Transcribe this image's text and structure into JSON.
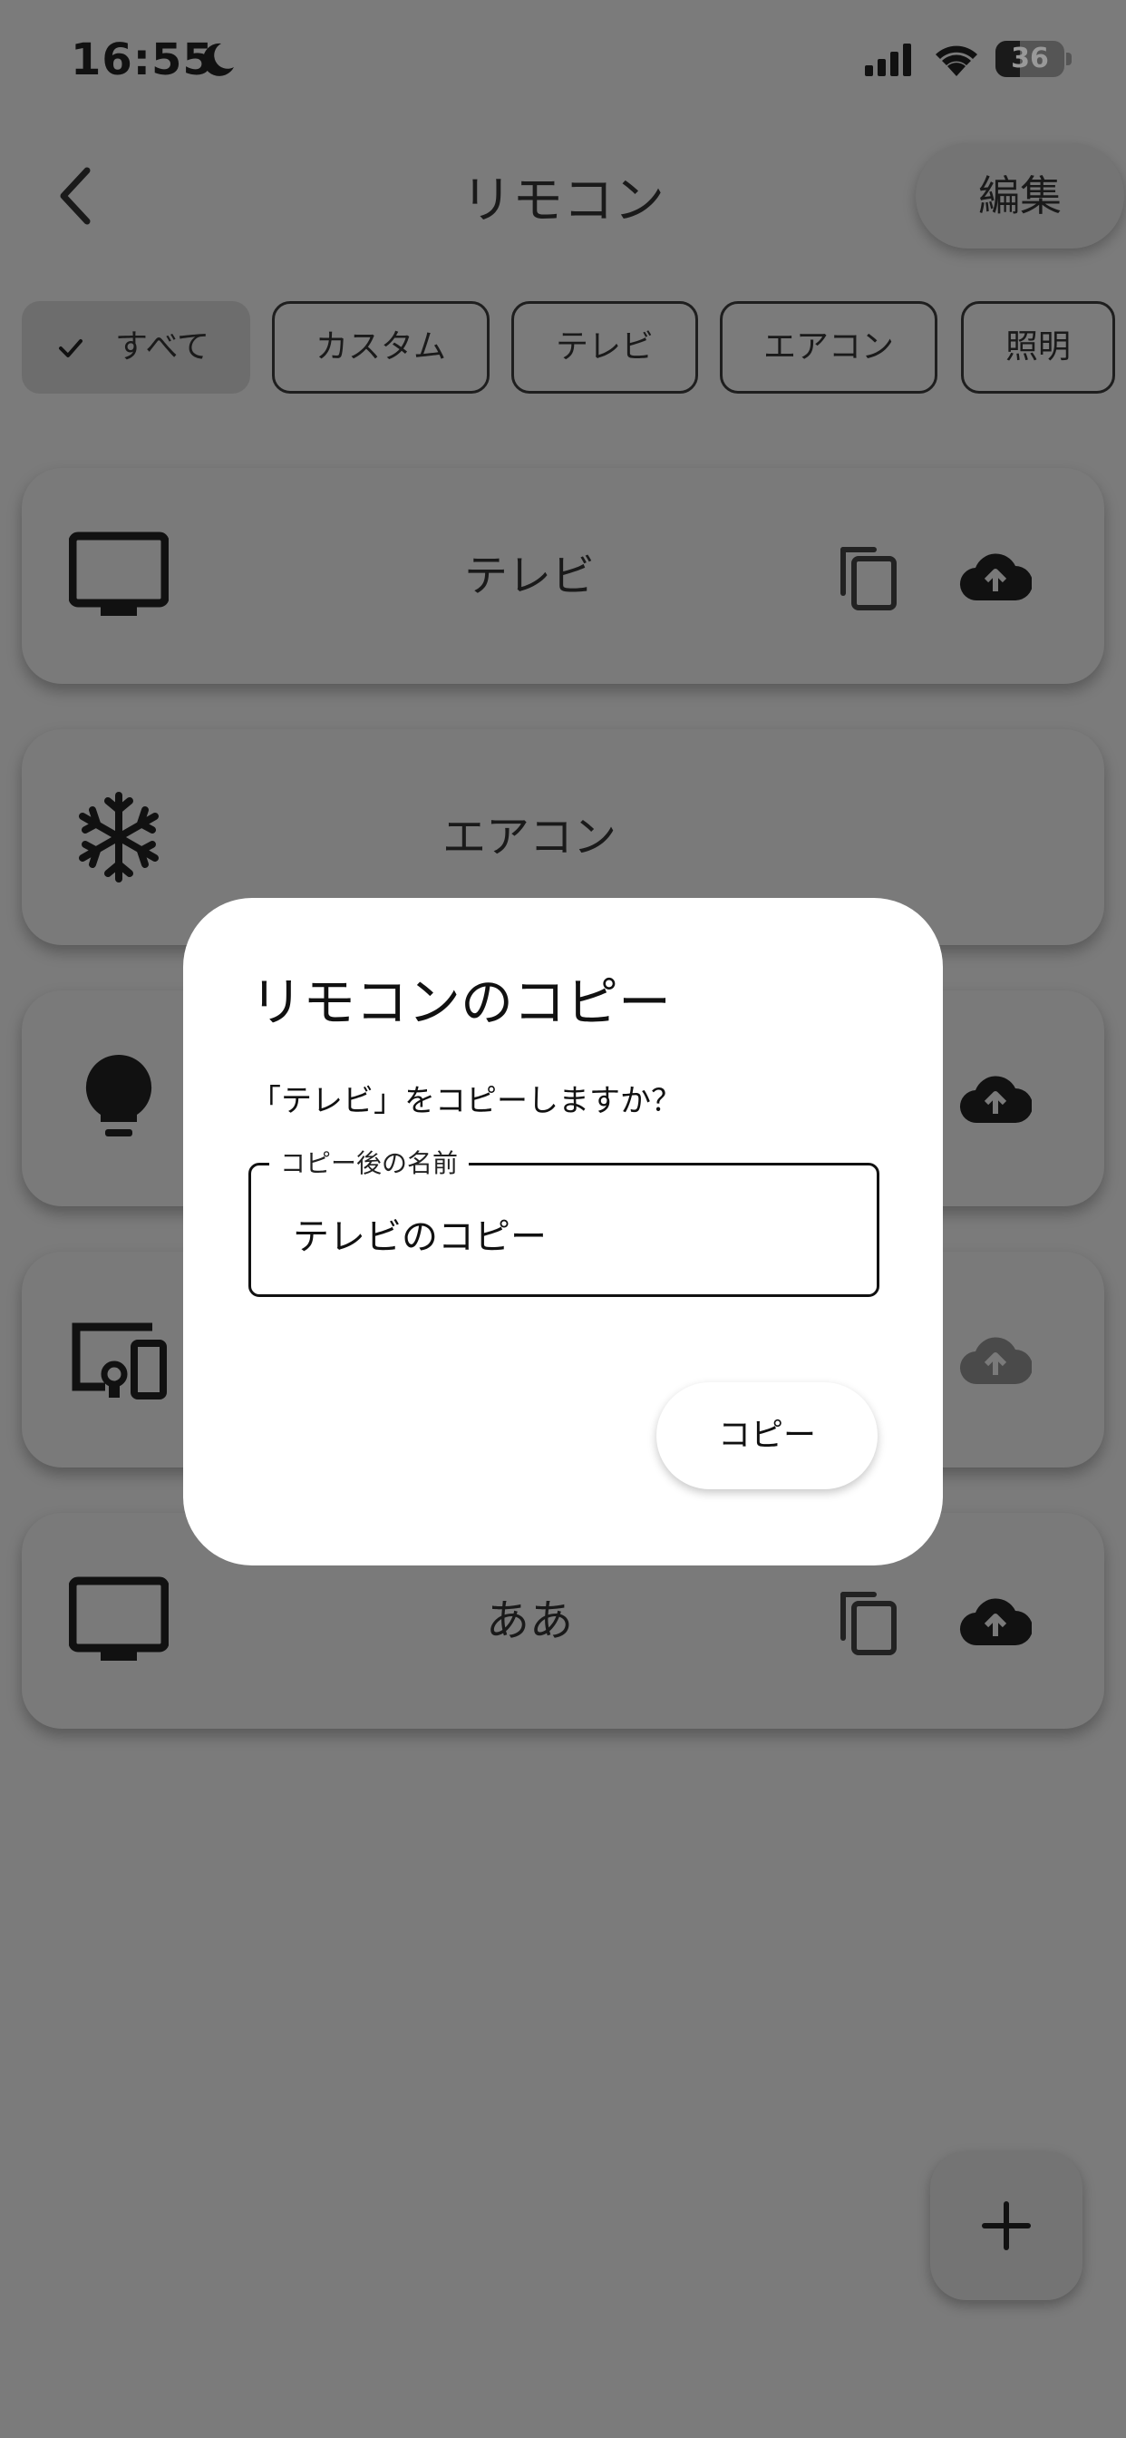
{
  "status_bar": {
    "time": "16:55",
    "battery": "36",
    "battery_level": 0.36
  },
  "header": {
    "back_icon": "chevron-left-icon",
    "title": "リモコン",
    "edit_label": "編集"
  },
  "filters": {
    "all": "すべて",
    "custom": "カスタム",
    "tv": "テレビ",
    "aircon": "エアコン",
    "light": "照明"
  },
  "remotes": [
    {
      "name": "テレビ",
      "icon": "tv-icon"
    },
    {
      "name": "エアコン",
      "icon": "snowflake-icon"
    },
    {
      "name": "",
      "icon": "lightbulb-icon"
    },
    {
      "name": "",
      "icon": "devices-icon"
    },
    {
      "name": "ああ",
      "icon": "tv-icon"
    }
  ],
  "dialog": {
    "title": "リモコンのコピー",
    "message": "「テレビ」をコピーしますか？",
    "field_label": "コピー後の名前",
    "field_value": "テレビのコピー",
    "confirm_label": "コピー"
  },
  "colors": {
    "scrim": "#7b7b7b",
    "dialog": "#ffffff",
    "text": "#111111"
  }
}
